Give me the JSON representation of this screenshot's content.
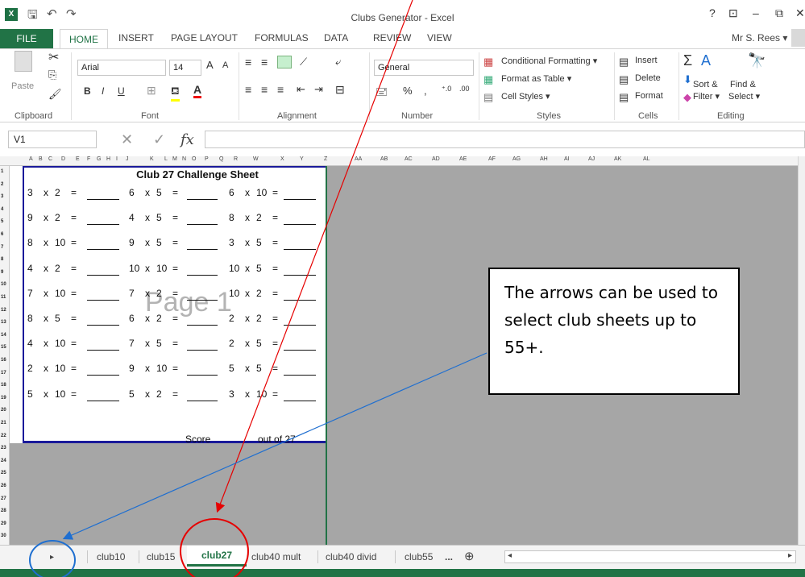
{
  "window": {
    "title": "Clubs Generator - Excel",
    "help": "?",
    "controls": [
      "⊡",
      "–",
      "⧉",
      "✕"
    ]
  },
  "qat": {
    "save_icon": "save-icon",
    "undo": "↶",
    "redo": "↷"
  },
  "ribbon_tabs": [
    "FILE",
    "HOME",
    "INSERT",
    "PAGE LAYOUT",
    "FORMULAS",
    "DATA",
    "REVIEW",
    "VIEW"
  ],
  "active_tab": "HOME",
  "user": "Mr S. Rees ▾",
  "clipboard": {
    "paste": "Paste",
    "label": "Clipboard"
  },
  "font": {
    "name": "Arial",
    "size": "14",
    "bold": "B",
    "italic": "I",
    "underline": "U",
    "grow": "A",
    "shrink": "A",
    "label": "Font"
  },
  "alignment": {
    "label": "Alignment"
  },
  "number": {
    "format": "General",
    "percent": "%",
    "comma": ",",
    "label": "Number"
  },
  "styles": {
    "conditional": "Conditional Formatting ▾",
    "table": "Format as Table ▾",
    "cell": "Cell Styles ▾",
    "label": "Styles"
  },
  "cells": {
    "insert": "Insert",
    "delete": "Delete",
    "format": "Format",
    "label": "Cells"
  },
  "editing": {
    "sort": "Sort &",
    "sort2": "Filter ▾",
    "find": "Find &",
    "find2": "Select ▾",
    "label": "Editing"
  },
  "formula_bar": {
    "name_box": "V1",
    "fx": "fx",
    "value": ""
  },
  "columns": [
    "A",
    "B",
    "C",
    "D",
    "E",
    "F",
    "G",
    "H",
    "I",
    "J",
    "K",
    "L",
    "M",
    "N",
    "O",
    "P",
    "Q",
    "R",
    "W",
    "X",
    "Y",
    "Z",
    "AA",
    "AB",
    "AC",
    "AD",
    "AE",
    "AF",
    "AG",
    "AH",
    "AI",
    "AJ",
    "AK",
    "AL"
  ],
  "rows": [
    "1",
    "2",
    "3",
    "4",
    "5",
    "6",
    "7",
    "8",
    "9",
    "10",
    "11",
    "12",
    "13",
    "14",
    "15",
    "16",
    "17",
    "18",
    "19",
    "20",
    "21",
    "22",
    "23",
    "24",
    "25",
    "26",
    "27",
    "28",
    "29",
    "30"
  ],
  "sheet_content": {
    "title": "Club 27 Challenge Sheet",
    "watermark": "Page 1",
    "score": "Score",
    "out_of": "out of 27",
    "problems": [
      [
        [
          "3",
          "x",
          "2",
          "="
        ],
        [
          "6",
          "x",
          "5",
          "="
        ],
        [
          "6",
          "x",
          "10",
          "="
        ]
      ],
      [
        [
          "9",
          "x",
          "2",
          "="
        ],
        [
          "4",
          "x",
          "5",
          "="
        ],
        [
          "8",
          "x",
          "2",
          "="
        ]
      ],
      [
        [
          "8",
          "x",
          "10",
          "="
        ],
        [
          "9",
          "x",
          "5",
          "="
        ],
        [
          "3",
          "x",
          "5",
          "="
        ]
      ],
      [
        [
          "4",
          "x",
          "2",
          "="
        ],
        [
          "10",
          "x",
          "10",
          "="
        ],
        [
          "10",
          "x",
          "5",
          "="
        ]
      ],
      [
        [
          "7",
          "x",
          "10",
          "="
        ],
        [
          "7",
          "x",
          "2",
          "="
        ],
        [
          "10",
          "x",
          "2",
          "="
        ]
      ],
      [
        [
          "8",
          "x",
          "5",
          "="
        ],
        [
          "6",
          "x",
          "2",
          "="
        ],
        [
          "2",
          "x",
          "2",
          "="
        ]
      ],
      [
        [
          "4",
          "x",
          "10",
          "="
        ],
        [
          "7",
          "x",
          "5",
          "="
        ],
        [
          "2",
          "x",
          "5",
          "="
        ]
      ],
      [
        [
          "2",
          "x",
          "10",
          "="
        ],
        [
          "9",
          "x",
          "10",
          "="
        ],
        [
          "5",
          "x",
          "5",
          "="
        ]
      ],
      [
        [
          "5",
          "x",
          "10",
          "="
        ],
        [
          "5",
          "x",
          "2",
          "="
        ],
        [
          "3",
          "x",
          "10",
          "="
        ]
      ]
    ]
  },
  "sheet_tabs": {
    "nav_arrow": "▸",
    "tabs": [
      "club10",
      "club15",
      "club27",
      "club40 mult",
      "club40 divid",
      "club55"
    ],
    "active": "club27",
    "more": "...",
    "add": "⊕"
  },
  "callout": {
    "text": "The arrows can be used to select club sheets up to 55+."
  },
  "colors": {
    "excel_green": "#217346",
    "sheet_border": "#1a1a9a",
    "annotation_red": "#e60000",
    "annotation_blue": "#1f6fd0",
    "gray_area": "#a6a6a6"
  }
}
